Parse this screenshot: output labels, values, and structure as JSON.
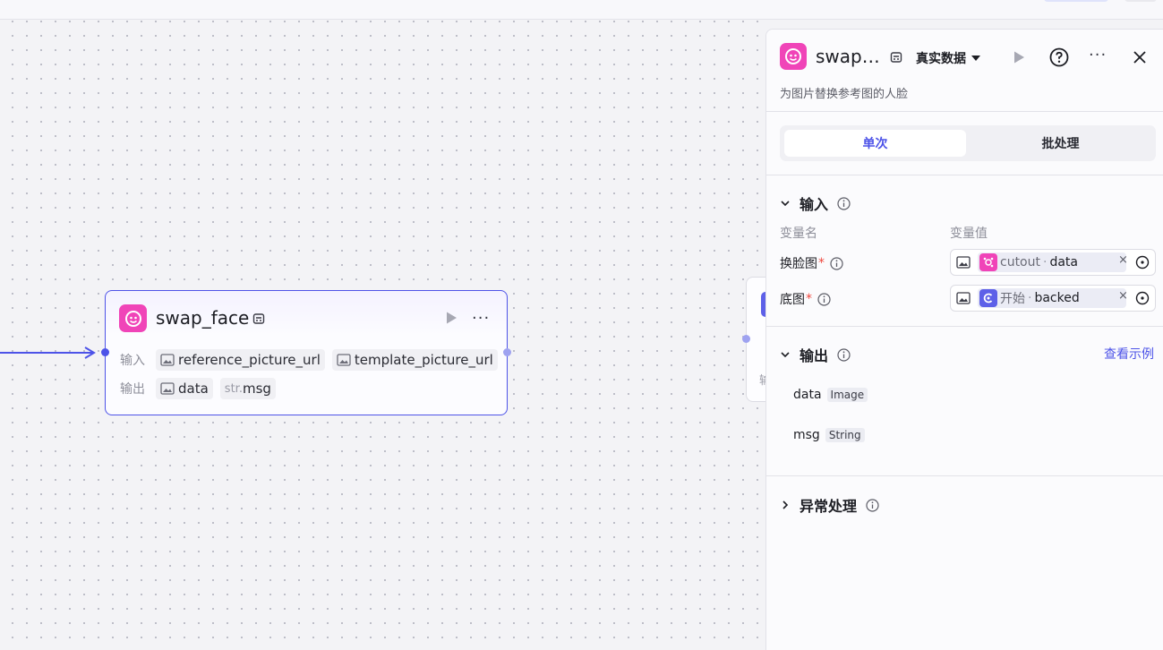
{
  "node": {
    "title": "swap_face",
    "input_label": "输入",
    "output_label": "输出",
    "inputs": [
      "reference_picture_url",
      "template_picture_url"
    ],
    "outputs": [
      {
        "type_prefix": "",
        "name": "data"
      },
      {
        "type_prefix": "str.",
        "name": "msg"
      }
    ]
  },
  "partial_node": {
    "label": "输"
  },
  "panel": {
    "title": "swap…",
    "data_mode": "真实数据",
    "description": "为图片替换参考图的人脸",
    "tabs": [
      "单次",
      "批处理"
    ],
    "input_section": {
      "title": "输入",
      "col_name": "变量名",
      "col_value": "变量值",
      "rows": [
        {
          "name": "换脸图",
          "ref_source": "cutout",
          "ref_field": "data"
        },
        {
          "name": "底图",
          "ref_source": "开始",
          "ref_field": "backed"
        }
      ]
    },
    "output_section": {
      "title": "输出",
      "link": "查看示例",
      "items": [
        {
          "name": "data",
          "type": "Image"
        },
        {
          "name": "msg",
          "type": "String"
        }
      ]
    },
    "exception_section": {
      "title": "异常处理"
    }
  },
  "colors": {
    "accent": "#4d53e8",
    "brand_pink": "#f044b8",
    "required": "#f0483e"
  },
  "icons": [
    "face-icon",
    "workflow-tag-icon",
    "play-icon",
    "more-icon",
    "image-icon",
    "help-icon",
    "close-icon",
    "chevron-icon",
    "info-icon",
    "clear-icon",
    "target-icon",
    "start-icon"
  ]
}
